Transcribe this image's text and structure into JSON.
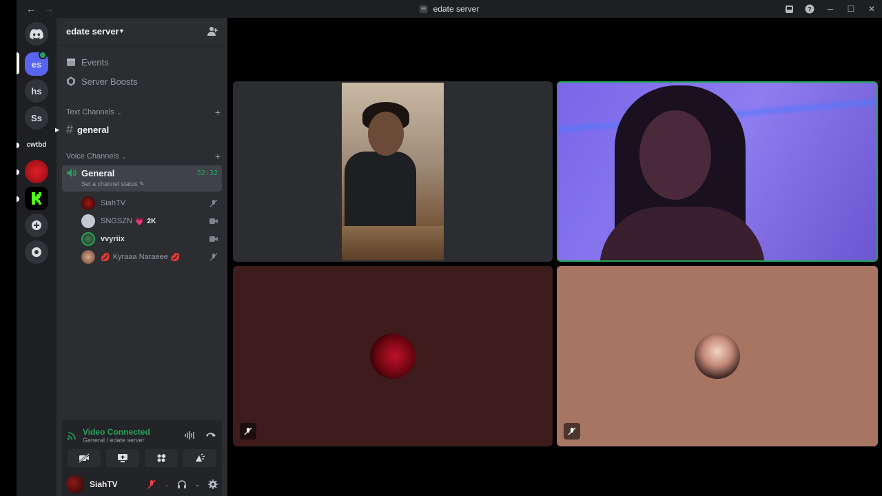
{
  "window": {
    "title": "edate server",
    "title_icon_text": "es"
  },
  "rail": {
    "servers": [
      {
        "label": "es",
        "selected": true
      },
      {
        "label": "hs"
      },
      {
        "label": "Ss"
      },
      {
        "label": "cwtbd"
      }
    ]
  },
  "sidebar": {
    "server_name": "edate server",
    "menu": [
      {
        "label": "Events",
        "icon": "calendar-icon"
      },
      {
        "label": "Server Boosts",
        "icon": "boost-icon"
      }
    ],
    "text_category": "Text Channels",
    "text_channels": [
      {
        "label": "general"
      }
    ],
    "voice_category": "Voice Channels",
    "voice_channel": {
      "name": "General",
      "timer": "52:32",
      "status": "Set a channel status"
    },
    "voice_users": [
      {
        "name": "SiahTV",
        "state": "muted",
        "avatar_color": "#5a0c0c"
      },
      {
        "name": "SNGSZN",
        "boost": "2K",
        "emoji": "💗",
        "state": "video",
        "avatar_color": "#9ea3b0"
      },
      {
        "name": "vvyriix",
        "state": "video",
        "avatar_color": "#2f5a3a",
        "highlight": true
      },
      {
        "name": "Kyraaa Naraeee",
        "emoji_prefix": "💋",
        "emoji_suffix": "💋",
        "state": "muted",
        "avatar_color": "#b07a60"
      }
    ]
  },
  "voice_panel": {
    "status": "Video Connected",
    "location": "General / edate server"
  },
  "user_panel": {
    "username": "SiahTV"
  },
  "colors": {
    "green": "#23a55a",
    "red": "#f23f42",
    "accent": "#5865f2"
  }
}
